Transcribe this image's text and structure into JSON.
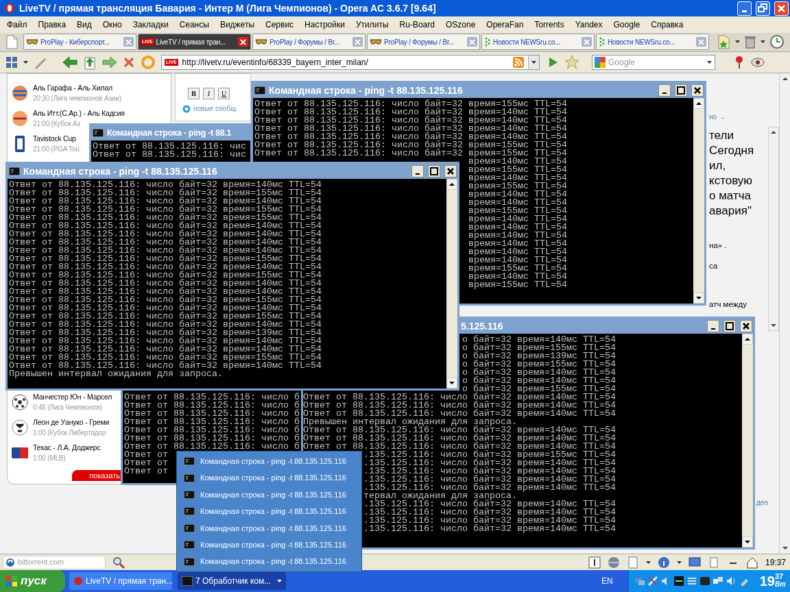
{
  "window": {
    "title": "LiveTV / прямая трансляция Бавария - Интер М (Лига Чемпионов) - Opera AC 3.6.7 [9.64]"
  },
  "menu": [
    "Файл",
    "Правка",
    "Вид",
    "Окно",
    "Закладки",
    "Сеансы",
    "Виджеты",
    "Сервис",
    "Настройки",
    "Утилиты",
    "Ru-Board",
    "OSzone",
    "OperaFan",
    "Torrents",
    "Yandex",
    "Google",
    "Справка"
  ],
  "tabs": [
    {
      "label": "ProPlay - Киберспорт...",
      "kind": "proplay",
      "selected": false
    },
    {
      "label": "LiveTV / прямая тран...",
      "kind": "live",
      "badge": "LIVE",
      "selected": true
    },
    {
      "label": "ProPlay / Форумы / Br...",
      "kind": "proplay",
      "selected": false
    },
    {
      "label": "ProPlay / Форумы / Br...",
      "kind": "proplay",
      "selected": false
    },
    {
      "label": "Новости NEWSru.co...",
      "kind": "news",
      "selected": false
    },
    {
      "label": "Новости NEWSru.co...",
      "kind": "news",
      "selected": false
    }
  ],
  "address_bar": {
    "badge": "LIVE",
    "url": "http://livetv.ru/eventinfo/68339_bayern_inter_milan/",
    "search_placeholder": "Google"
  },
  "page": {
    "formatting_buttons": [
      "B",
      "I",
      "U"
    ],
    "link_fragment": "новые сообщ",
    "matches": [
      {
        "title": "Аль Гарафа - Аль Хилал",
        "subtitle": "20:30 (Лига чемпионов Азии)"
      },
      {
        "title": "Аль Итт.(С.Ар.) - Аль Кадсия",
        "subtitle": "21:00 (Кубок Аз"
      },
      {
        "title": "Tavistock Cup",
        "subtitle": "21:00 (PGA Tou"
      },
      {
        "title": "Манчестер Юн - Марсел",
        "subtitle": "0:45 (Лига Чемпионов)"
      },
      {
        "title": "Леон де Уануко - Греми",
        "subtitle": "1:00 (Кубок Либертадор"
      },
      {
        "title": "Техас - Л.А. Доджерс",
        "subtitle": "1:00 (MLB)"
      }
    ],
    "show_button": "показать",
    "article_fragments": [
      {
        "kind": "link",
        "text": "но →"
      },
      {
        "kind": "heading",
        "text": "тели"
      },
      {
        "kind": "heading",
        "text": "Сегодня"
      },
      {
        "kind": "heading",
        "text": "ил,"
      },
      {
        "kind": "heading",
        "text": "кстовую"
      },
      {
        "kind": "heading",
        "text": "о матча"
      },
      {
        "kind": "heading",
        "text": "авария\""
      },
      {
        "kind": "text",
        "text": "на» ."
      },
      {
        "kind": "text",
        "text": "са"
      },
      {
        "kind": "text",
        "text": "атч между"
      },
      {
        "kind": "link",
        "text": "део"
      }
    ]
  },
  "consoles": [
    {
      "title": "Командная строка - ping -t 88.135.125.116",
      "lines": [
        "Ответ от 88.135.125.116: число байт=32 время=155мс TTL=54",
        "Ответ от 88.135.125.116: число байт=32 время=140мс TTL=54",
        "Ответ от 88.135.125.116: число байт=32 время=140мс TTL=54",
        "Ответ от 88.135.125.116: число байт=32 время=140мс TTL=54",
        "Ответ от 88.135.125.116: число байт=32 время=140мс TTL=54",
        "Ответ от 88.135.125.116: число байт=32 время=155мс TTL=54",
        "Ответ от 88.135.125.116: число байт=32 время=155мс TTL=54",
        "время=140мс TTL=54",
        "время=155мс TTL=54",
        "время=140мс TTL=54",
        "время=155мс TTL=54",
        "время=140мс TTL=54",
        "время=140мс TTL=54",
        "время=155мс TTL=54",
        "время=140мс TTL=54",
        "время=140мс TTL=54",
        "время=140мс TTL=54",
        "время=140мс TTL=54",
        "время=140мс TTL=54",
        "время=140мс TTL=54",
        "время=155мс TTL=54",
        "время=140мс TTL=54",
        "время=155мс TTL=54"
      ]
    },
    {
      "title": "Командная строка - ping -t 88.1",
      "lines": [
        "Ответ от 88.135.125.116: чис",
        "Ответ от 88.135.125.116: чис"
      ]
    },
    {
      "title": "Командная строка - ping -t 88.135.125.116",
      "lines": [
        "Ответ от 88.135.125.116: число байт=32 время=140мс TTL=54",
        "Ответ от 88.135.125.116: число байт=32 время=155мс TTL=54",
        "Ответ от 88.135.125.116: число байт=32 время=140мс TTL=54",
        "Ответ от 88.135.125.116: число байт=32 время=155мс TTL=54",
        "Ответ от 88.135.125.116: число байт=32 время=155мс TTL=54",
        "Ответ от 88.135.125.116: число байт=32 время=140мс TTL=54",
        "Ответ от 88.135.125.116: число байт=32 время=140мс TTL=54",
        "Ответ от 88.135.125.116: число байт=32 время=140мс TTL=54",
        "Ответ от 88.135.125.116: число байт=32 время=140мс TTL=54",
        "Ответ от 88.135.125.116: число байт=32 время=155мс TTL=54",
        "Ответ от 88.135.125.116: число байт=32 время=140мс TTL=54",
        "Ответ от 88.135.125.116: число байт=32 время=155мс TTL=54",
        "Ответ от 88.135.125.116: число байт=32 время=140мс TTL=54",
        "Ответ от 88.135.125.116: число байт=32 время=140мс TTL=54",
        "Ответ от 88.135.125.116: число байт=32 время=155мс TTL=54",
        "Ответ от 88.135.125.116: число байт=32 время=140мс TTL=54",
        "Ответ от 88.135.125.116: число байт=32 время=155мс TTL=54",
        "Ответ от 88.135.125.116: число байт=32 время=140мс TTL=54",
        "Ответ от 88.135.125.116: число байт=32 время=139мс TTL=54",
        "Ответ от 88.135.125.116: число байт=32 время=140мс TTL=54",
        "Ответ от 88.135.125.116: число байт=32 время=140мс TTL=54",
        "Ответ от 88.135.125.116: число байт=32 время=155мс TTL=54",
        "Ответ от 88.135.125.116: число байт=32 время=140мс TTL=54",
        "Превышен интервал ожидания для запроса."
      ]
    },
    {
      "title": "5.125.116",
      "lines": [
        "о байт=32 время=140мс TTL=54",
        "о байт=32 время=155мс TTL=54",
        "о байт=32 время=139мс TTL=54",
        "о байт=32 время=155мс TTL=54",
        "о байт=32 время=140мс TTL=54",
        "о байт=32 время=140мс TTL=54",
        "о байт=32 время=155мс TTL=54",
        "Ответ от 88.135.125.116: число байт=32 время=140мс TTL=54",
        "Ответ от 88.135.125.116: число байт=32 время=140мс TTL=54",
        "Ответ от 88.135.125.116: число байт=32 время=140мс TTL=54",
        "Превышен интервал ожидания для запроса.",
        "Ответ от 88.135.125.116: число байт=32 время=140мс TTL=54",
        "Ответ от 88.135.125.116: число байт=32 время=140мс TTL=54",
        "Ответ от 88.135.125.116: число байт=32 время=140мс TTL=54",
        ".135.125.116: число байт=32 время=155мс TTL=54",
        ".135.125.116: число байт=32 время=140мс TTL=54",
        ".135.125.116: число байт=32 время=140мс TTL=54",
        ".135.125.116: число байт=32 время=140мс TTL=54",
        ".135.125.116: число байт=32 время=140мс TTL=54",
        "тервал ожидания для запроса.",
        ".135.125.116: число байт=32 время=140мс TTL=54",
        ".135.125.116: число байт=32 время=140мс TTL=54",
        ".135.125.116: число байт=32 время=140мс TTL=54",
        ".135.125.116: число байт=32 время=140мс TTL=54"
      ]
    },
    {
      "lines": [
        "Ответ от 88.135.125.116: число б",
        "Ответ от 88.135.125.116: число б",
        "Ответ от 88.135.125.116: число б",
        "Ответ от 88.135.125.116: число б",
        "Ответ от 88.135.125.116: число б",
        "Ответ от 88.135.125.116: число б",
        "Ответ от 88.135.125.116: число б",
        "Ответ от",
        "Ответ от",
        "Ответ от"
      ]
    }
  ],
  "taskbar_popup": {
    "items": [
      "Командная строка - ping -t 88.135.125.116",
      "Командная строка - ping -t 88.135.125.116",
      "Командная строка - ping -t 88.135.125.116",
      "Командная строка - ping -t 88.135.125.116",
      "Командная строка - ping -t 88.135.125.116",
      "Командная строка - ping -t 88.135.125.116",
      "Командная строка - ping -t 88.135.125.116"
    ]
  },
  "status_bar": {
    "search_placeholder": "bittorrent.com",
    "time": "19:37"
  },
  "taskbar": {
    "start": "пуск",
    "tasks": [
      {
        "kind": "window",
        "label": "LiveTV / прямая тран...",
        "selected": false
      },
      {
        "kind": "group",
        "label": "7 Обработчик ком...",
        "selected": true
      }
    ],
    "language": "EN",
    "clock_hours": "19",
    "clock_minutes": "37",
    "clock_day": "Вт"
  }
}
